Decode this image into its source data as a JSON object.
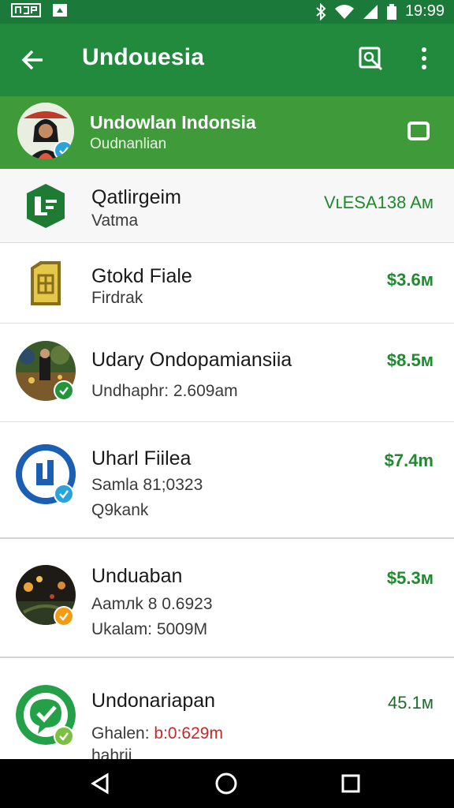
{
  "status_bar": {
    "left_icons": [
      "gallery-icon",
      "app-icon"
    ],
    "right_icons": [
      "bluetooth-icon",
      "wifi-icon",
      "signal-icon",
      "battery-icon"
    ],
    "time": "19:99"
  },
  "app_bar": {
    "title": "Undouesia",
    "icons": [
      "back-arrow-icon",
      "search-icon",
      "more-vert-icon"
    ]
  },
  "account": {
    "name": "Undowlan Indonsia",
    "subtitle": "Oudnanlian",
    "icon": "square-icon"
  },
  "items": [
    {
      "title": "Qatlirgeim",
      "lines": [
        "Vatma"
      ],
      "amount": "VʟESA138 Aᴍ",
      "icon": "spreadsheet-icon"
    },
    {
      "title": "Gtokd Fiale",
      "lines": [
        "Firdrak"
      ],
      "amount": "$3.6м",
      "icon": "document-icon"
    },
    {
      "title": "Udary Ondopamiansiia",
      "lines": [
        "Undhaphr: 2.609am"
      ],
      "amount": "$8.5м",
      "icon": "photo-avatar"
    },
    {
      "title": "Uharl Fiilea",
      "lines": [
        "Samla 81;0323",
        "Q9kank"
      ],
      "amount": "$7.4m",
      "icon": "music-app-icon"
    },
    {
      "title": "Unduaban",
      "lines": [
        "Aamлk 8 0.6923",
        "Ukalam: 5009M"
      ],
      "amount": "$5.3м",
      "icon": "night-photo-avatar"
    },
    {
      "title": "Undonariapan",
      "lines": [
        "Ghalen: b:0:629m",
        "hahrii"
      ],
      "amount": "45.1м",
      "icon": "chat-app-icon"
    }
  ],
  "nav_bar": {
    "icons": [
      "back-triangle-icon",
      "home-circle-icon",
      "recents-square-icon"
    ]
  },
  "colors": {
    "status_bar": "#1b7a3a",
    "app_bar": "#218a3d",
    "account_row": "#3f9b3a",
    "amount_green": "#1f8a2e",
    "red_text": "#c62828"
  }
}
